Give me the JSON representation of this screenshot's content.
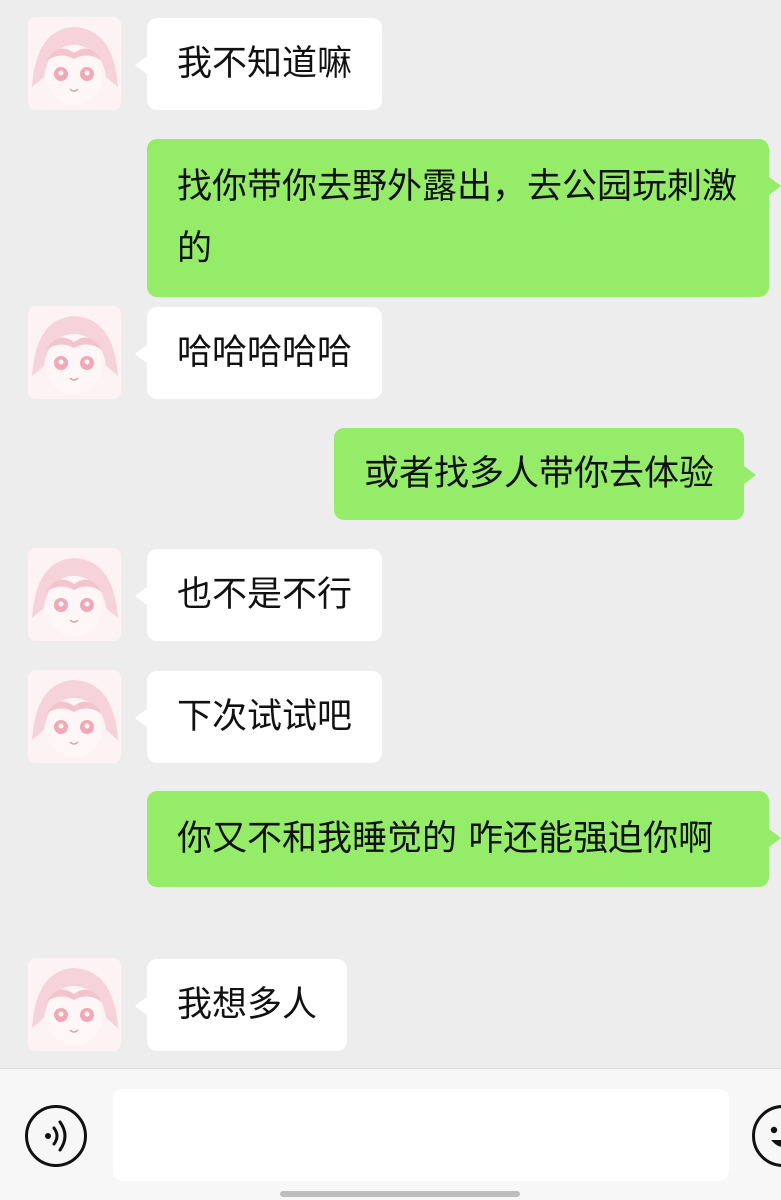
{
  "messages": [
    {
      "side": "in",
      "text": "我不知道嘛"
    },
    {
      "side": "out",
      "text": "找你带你去野外露出，去公园玩刺激的"
    },
    {
      "side": "in",
      "text": "哈哈哈哈哈"
    },
    {
      "side": "out",
      "text": "或者找多人带你去体验"
    },
    {
      "side": "in",
      "text": "也不是不行"
    },
    {
      "side": "in",
      "text": "下次试试吧"
    },
    {
      "side": "out",
      "text": "你又不和我睡觉的  咋还能强迫你啊"
    },
    {
      "side": "in",
      "text": "我想多人"
    }
  ],
  "input_bar": {
    "voice_icon": "voice-icon",
    "emoji_icon": "emoji-icon",
    "text_value": "",
    "text_placeholder": ""
  },
  "colors": {
    "background": "#ededed",
    "incoming_bubble": "#ffffff",
    "outgoing_bubble": "#95ec69",
    "input_bar": "#f7f7f7"
  }
}
